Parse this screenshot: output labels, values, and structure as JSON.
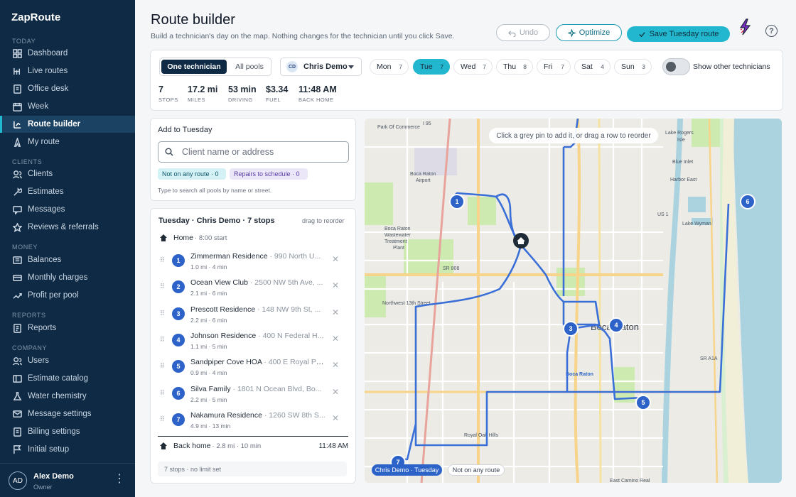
{
  "sidebar": {
    "brand": "ZapRoute",
    "sections": {
      "today": "TODAY",
      "clients": "CLIENTS",
      "money": "MONEY",
      "reports": "REPORTS",
      "company": "COMPANY"
    },
    "items": [
      {
        "label": "Dashboard",
        "icon": "dashboard-icon"
      },
      {
        "label": "Live routes",
        "icon": "live-routes-icon"
      },
      {
        "label": "Office desk",
        "icon": "office-desk-icon"
      },
      {
        "label": "Week",
        "icon": "calendar-icon"
      },
      {
        "label": "Route builder",
        "icon": "route-builder-icon",
        "active": true
      },
      {
        "label": "My route",
        "icon": "my-route-icon"
      },
      {
        "label": "Clients",
        "icon": "clients-icon"
      },
      {
        "label": "Estimates",
        "icon": "estimates-icon"
      },
      {
        "label": "Messages",
        "icon": "messages-icon"
      },
      {
        "label": "Reviews & referrals",
        "icon": "star-icon"
      },
      {
        "label": "Balances",
        "icon": "balances-icon"
      },
      {
        "label": "Monthly charges",
        "icon": "monthly-charges-icon"
      },
      {
        "label": "Profit per pool",
        "icon": "trend-icon"
      },
      {
        "label": "Reports",
        "icon": "reports-icon"
      },
      {
        "label": "Users",
        "icon": "users-icon"
      },
      {
        "label": "Estimate catalog",
        "icon": "catalog-icon"
      },
      {
        "label": "Water chemistry",
        "icon": "flask-icon"
      },
      {
        "label": "Message settings",
        "icon": "message-settings-icon"
      },
      {
        "label": "Billing settings",
        "icon": "billing-icon"
      },
      {
        "label": "Initial setup",
        "icon": "flag-icon"
      }
    ],
    "user": {
      "initials": "AD",
      "name": "Alex Demo",
      "role": "Owner"
    }
  },
  "header": {
    "title": "Route builder",
    "subtitle": "Build a technician's day on the map. Nothing changes for the technician until you click Save.",
    "undo": "Undo",
    "optimize": "Optimize",
    "save": "Save Tuesday route"
  },
  "toolbar": {
    "mode_one": "One technician",
    "mode_all": "All pools",
    "tech_initials": "CD",
    "tech_name": "Chris Demo",
    "days": [
      {
        "label": "Mon",
        "count": "7"
      },
      {
        "label": "Tue",
        "count": "7",
        "active": true
      },
      {
        "label": "Wed",
        "count": "7"
      },
      {
        "label": "Thu",
        "count": "8"
      },
      {
        "label": "Fri",
        "count": "7"
      },
      {
        "label": "Sat",
        "count": "4"
      },
      {
        "label": "Sun",
        "count": "3"
      }
    ],
    "toggle_label": "Show other technicians",
    "toggle_on": false
  },
  "stats": [
    {
      "value": "7",
      "label": "STOPS"
    },
    {
      "value": "17.2 mi",
      "label": "MILES"
    },
    {
      "value": "53 min",
      "label": "DRIVING"
    },
    {
      "value": "$3.34",
      "label": "FUEL"
    },
    {
      "value": "11:48 AM",
      "label": "BACK HOME"
    }
  ],
  "add_panel": {
    "title": "Add to Tuesday",
    "placeholder": "Client name or address",
    "pill_unrouted": "Not on any route · 0",
    "pill_repairs": "Repairs to schedule · 0",
    "hint": "Type to search all pools by name or street."
  },
  "route_list": {
    "heading": "Tuesday · Chris Demo · 7 stops",
    "drag_hint": "drag to reorder",
    "home_label": "Home",
    "home_sub": "· 8:00 start",
    "stops": [
      {
        "num": "1",
        "name": "Zimmerman Residence",
        "address": "· 990 North U...",
        "meta": "1.0 mi · 4 min"
      },
      {
        "num": "2",
        "name": "Ocean View Club",
        "address": "· 2500 NW 5th Ave, ...",
        "meta": "2.1 mi · 6 min"
      },
      {
        "num": "3",
        "name": "Prescott Residence",
        "address": "· 148 NW 9th St, ...",
        "meta": "2.2 mi · 6 min"
      },
      {
        "num": "4",
        "name": "Johnson Residence",
        "address": "· 400 N Federal H...",
        "meta": "1.1 mi · 5 min"
      },
      {
        "num": "5",
        "name": "Sandpiper Cove HOA",
        "address": "· 400 E Royal Pa...",
        "meta": "0.9 mi · 4 min"
      },
      {
        "num": "6",
        "name": "Silva Family",
        "address": "· 1801 N Ocean Blvd, Bo...",
        "meta": "2.2 mi · 5 min"
      },
      {
        "num": "7",
        "name": "Nakamura Residence",
        "address": "· 1260 SW 8th S...",
        "meta": "4.9 mi · 13 min"
      }
    ],
    "back_label": "Back home",
    "back_sub": "· 2.8 mi · 10 min",
    "back_time": "11:48 AM",
    "footer": "7 stops · no limit set"
  },
  "map": {
    "hint": "Click a grey pin to add it, or drag a row to reorder",
    "tag_route": "Chris Demo · Tuesday",
    "tag_unrouted": "Not on any route",
    "labels": [
      "Park Of Commerce",
      "I 95",
      "Boca Raton Airport",
      "Boca Raton Wastewater Treatment Plant",
      "SR 808",
      "Northwest 13th Street",
      "Boca Raton",
      "Royal Oak Hills",
      "US 1",
      "Lake Wyman",
      "Blue Inlet",
      "Harbor East",
      "Lake Rogers Isle",
      "SR A1A",
      "East Camino Real",
      "Boca Raton"
    ],
    "pins": [
      "1",
      "2",
      "3",
      "4",
      "5",
      "6",
      "7"
    ]
  }
}
